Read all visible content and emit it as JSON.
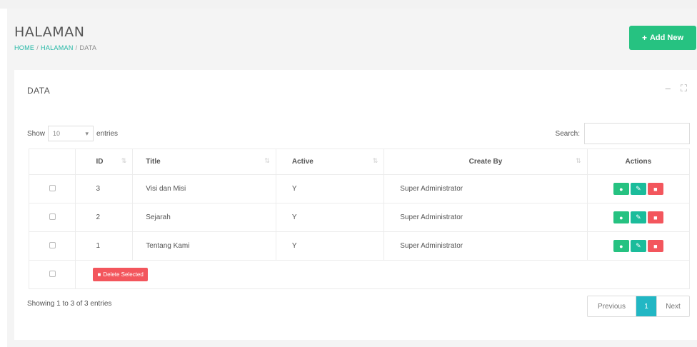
{
  "page": {
    "title": "HALAMAN",
    "breadcrumb": [
      "HOME",
      "HALAMAN",
      "DATA"
    ],
    "add_button": "Add New"
  },
  "card": {
    "title": "DATA",
    "tools": [
      "minimize-icon",
      "fullscreen-icon"
    ]
  },
  "datatable": {
    "show_label": "Show",
    "entries_value": "10",
    "entries_label": "entries",
    "search_label": "Search:",
    "search_value": "",
    "columns": [
      "",
      "ID",
      "Title",
      "Active",
      "Create By",
      "Actions"
    ],
    "rows": [
      {
        "id": "3",
        "title": "Visi dan Misi",
        "active": "Y",
        "create_by": "Super Administrator"
      },
      {
        "id": "2",
        "title": "Sejarah",
        "active": "Y",
        "create_by": "Super Administrator"
      },
      {
        "id": "1",
        "title": "Tentang Kami",
        "active": "Y",
        "create_by": "Super Administrator"
      }
    ],
    "delete_selected": "Delete Selected",
    "info": "Showing 1 to 3 of 3 entries",
    "pagination": {
      "previous": "Previous",
      "current": "1",
      "next": "Next"
    }
  },
  "colors": {
    "accent": "#22b7a5",
    "success": "#26c281",
    "danger": "#f3565d",
    "pager_active": "#22b7c4"
  }
}
